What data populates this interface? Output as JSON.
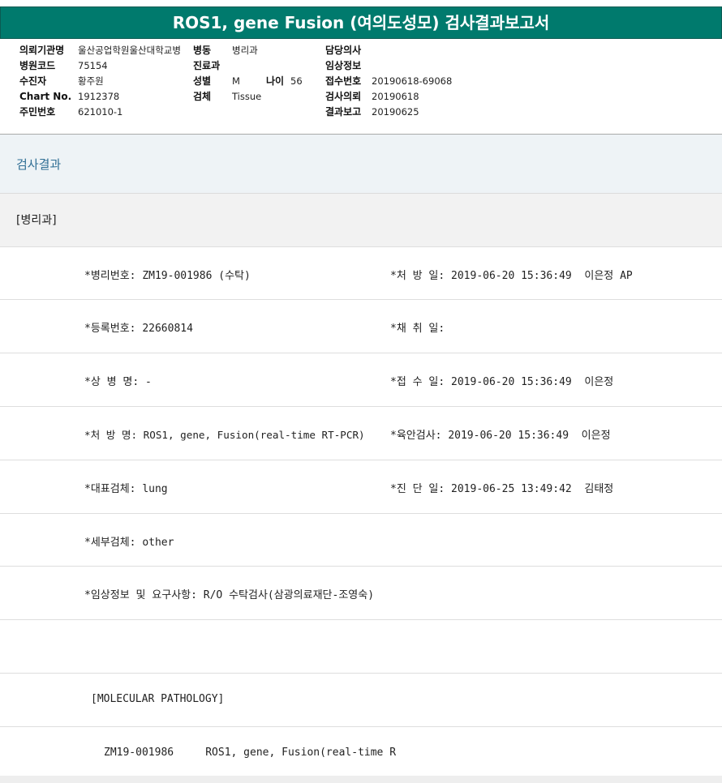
{
  "title": "ROS1, gene Fusion (여의도성모) 검사결과보고서",
  "header": {
    "col1": [
      {
        "label": "의뢰기관명",
        "value": "울산공업학원울산대학교병"
      },
      {
        "label": "병원코드",
        "value": "75154"
      },
      {
        "label": "수진자",
        "value": "황주원"
      },
      {
        "label": "Chart No.",
        "value": "1912378"
      },
      {
        "label": "주민번호",
        "value": "621010-1"
      }
    ],
    "col2": [
      {
        "label": "병동",
        "value": "병리과"
      },
      {
        "label": "진료과",
        "value": ""
      },
      {
        "label": "성별",
        "value": "M"
      },
      {
        "label": "검체",
        "value": "Tissue"
      }
    ],
    "age": {
      "label": "나이",
      "value": "56"
    },
    "col3": [
      {
        "label": "담당의사",
        "value": ""
      },
      {
        "label": "임상정보",
        "value": ""
      },
      {
        "label": "접수번호",
        "value": "20190618-69068"
      },
      {
        "label": "검사의뢰",
        "value": "20190618"
      },
      {
        "label": "결과보고",
        "value": "20190625"
      }
    ]
  },
  "sections": {
    "result": "검사결과",
    "dept": "[병리과]"
  },
  "report_rows": [
    {
      "left": "*병리번호: ZM19-001986 (수탁)",
      "right": "*처 방 일: 2019-06-20 15:36:49  이은정 AP"
    },
    {
      "left": "*등록번호: 22660814",
      "right": "*채 취 일:"
    },
    {
      "left": "*상 병 명: -",
      "right": "*접 수 일: 2019-06-20 15:36:49  이은정"
    },
    {
      "left": "*처 방 명: ROS1, gene, Fusion(real-time RT-PCR)",
      "right": "*육안검사: 2019-06-20 15:36:49  이은정"
    },
    {
      "left": "*대표검체: lung",
      "right": "*진 단 일: 2019-06-25 13:49:42  김태정"
    },
    {
      "left": "*세부검체: other",
      "right": ""
    },
    {
      "left": "*임상정보 및 요구사항: R/O 수탁검사(삼광의료재단-조영숙)",
      "right": ""
    }
  ],
  "molecular": {
    "heading": "[MOLECULAR PATHOLOGY]",
    "line": "ZM19-001986     ROS1, gene, Fusion(real-time R"
  }
}
